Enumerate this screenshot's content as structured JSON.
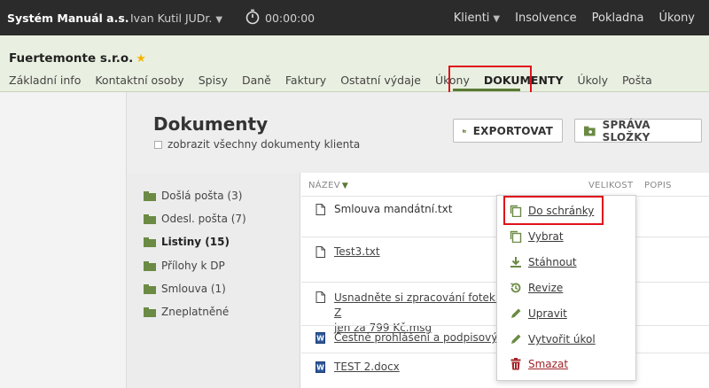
{
  "topbar": {
    "brand": "Systém Manuál a.s.",
    "user": "Ivan Kutil JUDr.",
    "timer": "00:00:00",
    "nav": [
      "Klienti",
      "Insolvence",
      "Pokladna",
      "Úkony"
    ]
  },
  "client": {
    "name": "Fuertemonte s.r.o.",
    "tabs": [
      "Základní info",
      "Kontaktní osoby",
      "Spisy",
      "Daně",
      "Faktury",
      "Ostatní výdaje",
      "Úkony",
      "DOKUMENTY",
      "Úkoly",
      "Pošta"
    ],
    "active_tab": "DOKUMENTY"
  },
  "documents": {
    "title": "Dokumenty",
    "show_all_label": "zobrazit všechny dokumenty klienta",
    "export_label": "EXPORTOVAT",
    "folder_admin_label": "SPRÁVA SLOŽKY"
  },
  "folders": [
    {
      "label": "Došlá pošta (3)"
    },
    {
      "label": "Odesl. pošta (7)"
    },
    {
      "label": "Listiny (15)"
    },
    {
      "label": "Přílohy k DP"
    },
    {
      "label": "Smlouva (1)"
    },
    {
      "label": "Zneplatněné"
    }
  ],
  "columns": {
    "name": "NÁZEV",
    "size": "VELIKOST",
    "desc": "POPIS"
  },
  "files": [
    {
      "name": "Smlouva mandátní.txt"
    },
    {
      "name": "Test3.txt"
    },
    {
      "name_line1": "Usnadněte si zpracování fotek - Z",
      "name_line2": "jen za 799 Kč.msg"
    },
    {
      "name": "Čestné prohlášení a podpisový vz"
    },
    {
      "name": "TEST 2.docx"
    }
  ],
  "context_menu": [
    {
      "label": "Do schránky",
      "icon": "copy-icon"
    },
    {
      "label": "Vybrat",
      "icon": "copy-icon"
    },
    {
      "label": "Stáhnout",
      "icon": "download-icon"
    },
    {
      "label": "Revize",
      "icon": "history-icon"
    },
    {
      "label": "Upravit",
      "icon": "pencil-icon"
    },
    {
      "label": "Vytvořit úkol",
      "icon": "pencil-icon"
    },
    {
      "label": "Smazat",
      "icon": "trash-icon"
    }
  ],
  "colors": {
    "accent_green": "#5a7a36",
    "highlight_red": "#e0111b",
    "topbar_bg": "#2b2b2b",
    "danger": "#a3252a"
  }
}
